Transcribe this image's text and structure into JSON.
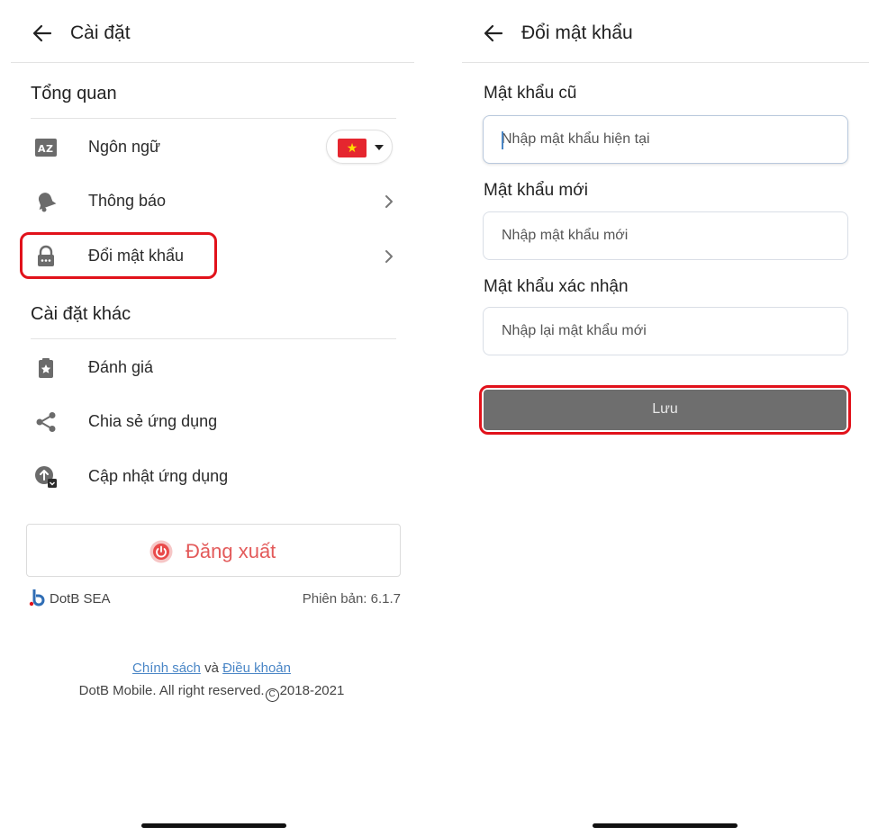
{
  "settings": {
    "title": "Cài đặt",
    "section_general": "Tổng quan",
    "items_general": [
      {
        "label": "Ngôn ngữ",
        "icon": "translate-icon"
      },
      {
        "label": "Thông báo",
        "icon": "bell-icon"
      },
      {
        "label": "Đổi mật khẩu",
        "icon": "lock-icon"
      }
    ],
    "language_flag": "vietnam-flag-icon",
    "section_other": "Cài đặt khác",
    "items_other": [
      {
        "label": "Đánh giá",
        "icon": "rate-star-icon"
      },
      {
        "label": "Chia sẻ ứng dụng",
        "icon": "share-icon"
      },
      {
        "label": "Cập nhật ứng dụng",
        "icon": "update-icon"
      }
    ],
    "logout_label": "Đăng xuất",
    "brand_name": "DotB SEA",
    "version": "Phiên bản: 6.1.7",
    "policy_link": "Chính sách",
    "and_text": "và",
    "terms_link": "Điều khoản",
    "copyright_prefix": "DotB Mobile. All right reserved.",
    "copyright_symbol": "C",
    "copyright_years": "2018-2021"
  },
  "change_password": {
    "title": "Đổi mật khẩu",
    "old_label": "Mật khẩu cũ",
    "old_placeholder": "Nhập mật khẩu hiện tại",
    "new_label": "Mật khẩu mới",
    "new_placeholder": "Nhập mật khẩu mới",
    "confirm_label": "Mật khẩu xác nhận",
    "confirm_placeholder": "Nhập lại mật khẩu mới",
    "save_label": "Lưu"
  },
  "colors": {
    "highlight": "#e1121b",
    "logout_text": "#e35a5a",
    "link": "#4a86c6",
    "save_button": "#6e6e6e"
  }
}
